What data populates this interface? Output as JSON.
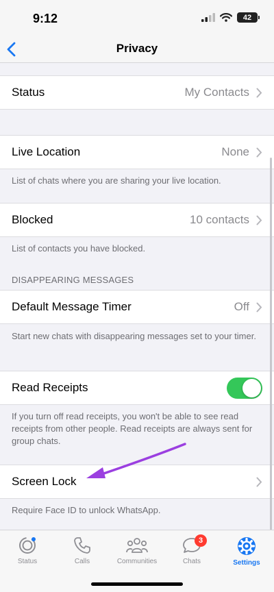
{
  "status_bar": {
    "time": "9:12",
    "battery": "42"
  },
  "nav": {
    "title": "Privacy"
  },
  "rows": {
    "status": {
      "label": "Status",
      "value": "My Contacts"
    },
    "live_location": {
      "label": "Live Location",
      "value": "None",
      "footer": "List of chats where you are sharing your live location."
    },
    "blocked": {
      "label": "Blocked",
      "value": "10 contacts",
      "footer": "List of contacts you have blocked."
    },
    "disappearing_header": "DISAPPEARING MESSAGES",
    "default_timer": {
      "label": "Default Message Timer",
      "value": "Off",
      "footer": "Start new chats with disappearing messages set to your timer."
    },
    "read_receipts": {
      "label": "Read Receipts",
      "enabled": true,
      "footer": "If you turn off read receipts, you won't be able to see read receipts from other people. Read receipts are always sent for group chats."
    },
    "screen_lock": {
      "label": "Screen Lock",
      "footer": "Require Face ID to unlock WhatsApp."
    }
  },
  "tabbar": {
    "tabs": [
      {
        "label": "Status",
        "icon": "status-icon",
        "active": false
      },
      {
        "label": "Calls",
        "icon": "phone-icon",
        "active": false
      },
      {
        "label": "Communities",
        "icon": "communities-icon",
        "active": false
      },
      {
        "label": "Chats",
        "icon": "chats-icon",
        "active": false,
        "badge": "3"
      },
      {
        "label": "Settings",
        "icon": "gear-icon",
        "active": true
      }
    ]
  },
  "colors": {
    "accent": "#1877f2",
    "toggle_on": "#34c759",
    "badge": "#ff3b30",
    "arrow": "#9b3fe0"
  }
}
